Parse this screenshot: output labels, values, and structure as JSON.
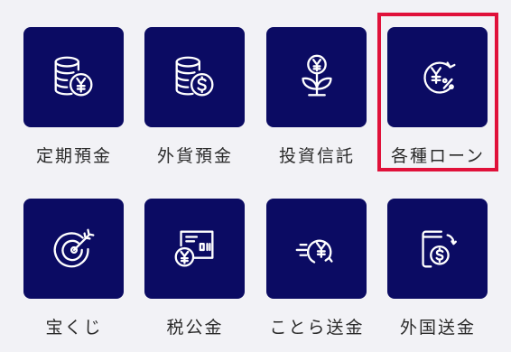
{
  "menu": {
    "items": [
      {
        "label": "定期預金",
        "icon": "coin-stack-yen-icon"
      },
      {
        "label": "外貨預金",
        "icon": "coin-stack-dollar-icon"
      },
      {
        "label": "投資信託",
        "icon": "yen-sprout-icon"
      },
      {
        "label": "各種ローン",
        "icon": "yen-percent-circle-icon"
      },
      {
        "label": "宝くじ",
        "icon": "target-arrow-icon"
      },
      {
        "label": "税公金",
        "icon": "bill-yen-icon"
      },
      {
        "label": "ことら送金",
        "icon": "yen-transfer-icon"
      },
      {
        "label": "外国送金",
        "icon": "phone-dollar-icon"
      }
    ],
    "highlighted_item": "各種ローン"
  },
  "colors": {
    "background": "#f2f2f6",
    "tile": "#0b0b63",
    "icon_stroke": "#ffffff",
    "label_text": "#2b2b2b",
    "highlight": "#e0113a"
  }
}
